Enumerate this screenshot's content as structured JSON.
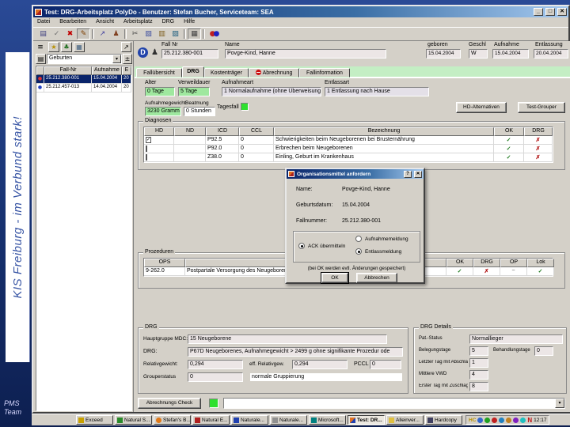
{
  "slide": {
    "banner": "KIS Freiburg - im Verbund stark!",
    "team_line1": "PMS",
    "team_line2": "Team"
  },
  "window": {
    "title": "Test: DRG-Arbeitsplatz PolyDo - Benutzer: Stefan Bucher, Serviceteam: SEA",
    "menus": [
      "Datei",
      "Bearbeiten",
      "Ansicht",
      "Arbeitsplatz",
      "DRG",
      "Hilfe"
    ],
    "min_glyph": "_",
    "max_glyph": "□",
    "close_glyph": "✕"
  },
  "toolbar": {
    "icons": [
      {
        "name": "save",
        "glyph": "▤"
      },
      {
        "name": "confirm",
        "glyph": "✓"
      },
      {
        "name": "delete",
        "glyph": "✖"
      },
      {
        "name": "edit",
        "glyph": "✎"
      },
      {
        "name": "route",
        "glyph": "↗"
      },
      {
        "name": "person",
        "glyph": "♟"
      },
      {
        "name": "cut",
        "glyph": "✂"
      },
      {
        "name": "copy",
        "glyph": "▧"
      },
      {
        "name": "paste",
        "glyph": "▥"
      },
      {
        "name": "book",
        "glyph": "▨"
      },
      {
        "name": "grid",
        "glyph": "▦"
      },
      {
        "name": "ring_left",
        "glyph": "●"
      },
      {
        "name": "ring_right",
        "glyph": "●"
      }
    ]
  },
  "glyphs": {
    "dropdown": "▾",
    "dot": "●"
  },
  "patient": {
    "logo_glyph": "D",
    "person_glyph": "♟",
    "fall_nr_label": "Fall Nr",
    "fall_nr": "25.212.380-001",
    "name_label": "Name",
    "name": "Povge-Kind, Hanne",
    "geboren_label": "geboren",
    "geboren": "15.04.2004",
    "geschl_label": "Geschl",
    "geschl": "W",
    "aufnahme_label": "Aufnahme",
    "aufnahme": "15.04.2004",
    "entlassung_label": "Entlassung",
    "entlassung": "20.04.2004"
  },
  "tabs": {
    "falluebersicht": "Fallübersicht",
    "drg": "DRG",
    "kostentraeger": "Kostenträger",
    "abrechnung": "Abrechnung",
    "fallinformation": "Fallinformation"
  },
  "fall_list": {
    "filter": "Geburten",
    "icons": {
      "list": "≡",
      "star": "★",
      "tree": "♣",
      "monitor": "▦",
      "export": "↗",
      "pm": "±",
      "header_btn": "▤"
    },
    "col_fallnr": "Fall-Nr",
    "col_aufnahme": "Aufnahme",
    "col_e": "E",
    "rows": [
      {
        "fall_nr": "25.212.380-001",
        "aufnahme": "15.04.2004",
        "e": "20"
      },
      {
        "fall_nr": "25.212.457-013",
        "aufnahme": "14.04.2004",
        "e": "20"
      }
    ]
  },
  "drg_tab": {
    "alter_label": "Alter",
    "alter": "0 Tage",
    "verweildauer_label": "Verweildauer",
    "verweildauer": "5 Tage",
    "aufnahmeart_label": "Aufnahmeart",
    "aufnahmeart": "1 Normalaufnahme (ohne Überweisung)",
    "entlassart_label": "Entlassart",
    "entlassart": "1 Entlassung nach Hause",
    "aufnahmegewicht_label": "Aufnahmegewicht",
    "aufnahmegewicht": "3230 Gramm",
    "beatmung_label": "Beatmung",
    "beatmung": "0 Stunden",
    "tagesfall_label": "Tagesfall",
    "hd_alternativen_button": "HD-Alternativen",
    "test_grouper_button": "Test-Grouper",
    "abrechnungs_check_button": "Abrechnungs Check",
    "diagnosen": {
      "title": "Diagnosen",
      "col_hd": "HD",
      "col_nd": "ND",
      "col_icd": "ICD",
      "col_ccl": "CCL",
      "col_bezeichnung": "Bezeichnung",
      "col_ok": "OK",
      "col_drg": "DRG",
      "rows": [
        {
          "hd": "✓",
          "icd": "P92.5",
          "ccl": "0",
          "bezeichnung": "Schwierigkeiten beim Neugeborenen bei Brusternährung",
          "ok": "✓",
          "drg": "✗"
        },
        {
          "hd": "",
          "icd": "P92.0",
          "ccl": "0",
          "bezeichnung": "Erbrechen beim Neugeborenen",
          "ok": "✓",
          "drg": "✗"
        },
        {
          "hd": "",
          "icd": "Z38.0",
          "ccl": "0",
          "bezeichnung": "Einling, Geburt im Krankenhaus",
          "ok": "✓",
          "drg": "✗"
        }
      ]
    },
    "prozeduren": {
      "title": "Prozeduren",
      "col_ops": "OPS",
      "col_bezeichnung": "Bezeichnung",
      "col_ok": "OK",
      "col_drg": "DRG",
      "col_op": "OP",
      "col_lok": "Lok",
      "rows": [
        {
          "ops": "9-262.0",
          "bezeichnung": "Postpartale Versorgung des Neugeborenen",
          "ok": "✓",
          "drg": "✗",
          "op": "~",
          "lok": "✓"
        }
      ]
    },
    "drg_box": {
      "title": "DRG",
      "mdc_label": "Hauptgruppe MDC:",
      "mdc": "15   Neugeborene",
      "drg_label": "DRG:",
      "drg": "P67D   Neugeborenes, Aufnahmegewicht > 2499 g ohne signifikante Prozedur ode",
      "relativgewicht_label": "Relativgewicht:",
      "relativgewicht": "0,294",
      "eff_relativgew_label": "eff. Relativgew.",
      "eff_relativgew": "0,294",
      "pccl_label": "PCCL",
      "pccl": "0",
      "grouperstatus_label": "Grouperstatus",
      "grouperstatus": "0",
      "grouperstatus_text": "normale Gruppierung"
    },
    "drg_details": {
      "title": "DRG Details",
      "pat_status_label": "Pat.-Status",
      "pat_status": "Normallieger",
      "belegungstage_label": "Belegungstage",
      "belegungstage": "5",
      "behandlungstage_label": "Behandlungstage",
      "behandlungstage": "0",
      "letzter_tag_label": "Letzter Tag mit Abschlag",
      "letzter_tag": "1",
      "mittlere_vwd_label": "Mittlere VWD",
      "mittlere_vwd": "4",
      "erster_tag_label": "Erster Tag mit Zuschlag",
      "erster_tag": "8"
    }
  },
  "dialog": {
    "title": "Organisationsmittel anfordern",
    "help_glyph": "?",
    "close_glyph": "✕",
    "name_label": "Name:",
    "name": "Povge-Kind, Hanne",
    "geburtsdatum_label": "Geburtsdatum:",
    "geburtsdatum": "15.04.2004",
    "fallnummer_label": "Fallnummer:",
    "fallnummer": "25.212.380-001",
    "radio_ack": "ACK übermitteln",
    "radio_aufnahme": "Aufnahmemeldung",
    "radio_entlass": "Entlassmeldung",
    "hint": "(bei OK werden evtl. Änderungen gespeichert)",
    "ok_button": "OK",
    "abbrechen_button": "Abbrechen"
  },
  "taskbar": {
    "buttons": [
      "Exceed",
      "Natural S...",
      "Stefan's B...",
      "Natural E...",
      "Naturale...",
      "Naturale...",
      "Microsoft...",
      "Test: DR...",
      "Alleinver...",
      "Hardcopy"
    ],
    "tray_hc": "HC",
    "tray_n": "N",
    "clock": "12:17"
  },
  "colors": {
    "titlebar": "#0a246a",
    "titlebar_light": "#a6caf0",
    "field_green": "#9fe89f",
    "selected_row": "#0a246a",
    "check_green": "#1e7a1e",
    "cross_red": "#b01010",
    "slide_blue": "#16306e",
    "indicator_green": "#2ee02e",
    "tab_strip_mint": "#c4eec4"
  }
}
